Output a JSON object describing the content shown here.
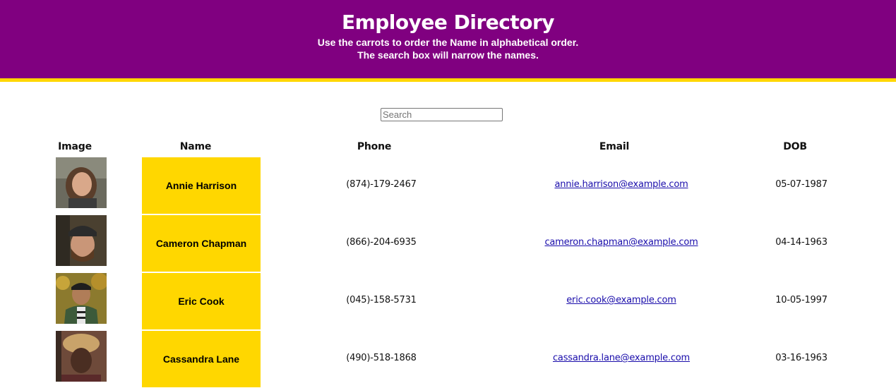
{
  "header": {
    "title": "Employee Directory",
    "subtitle_line1": "Use the carrots to order the Name in alphabetical order.",
    "subtitle_line2": "The search box will narrow the names.",
    "background_color": "#800080",
    "accent_color": "#ffd700"
  },
  "search": {
    "placeholder": "Search",
    "value": ""
  },
  "table": {
    "columns": [
      "Image",
      "Name",
      "Phone",
      "Email",
      "DOB"
    ],
    "rows": [
      {
        "name": "Annie Harrison",
        "phone": "(874)-179-2467",
        "email": "annie.harrison@example.com",
        "dob": "05-07-1987",
        "image": "person-photo"
      },
      {
        "name": "Cameron Chapman",
        "phone": "(866)-204-6935",
        "email": "cameron.chapman@example.com",
        "dob": "04-14-1963",
        "image": "person-photo"
      },
      {
        "name": "Eric Cook",
        "phone": "(045)-158-5731",
        "email": "eric.cook@example.com",
        "dob": "10-05-1997",
        "image": "person-photo"
      },
      {
        "name": "Cassandra Lane",
        "phone": "(490)-518-1868",
        "email": "cassandra.lane@example.com",
        "dob": "03-16-1963",
        "image": "person-photo"
      }
    ]
  }
}
